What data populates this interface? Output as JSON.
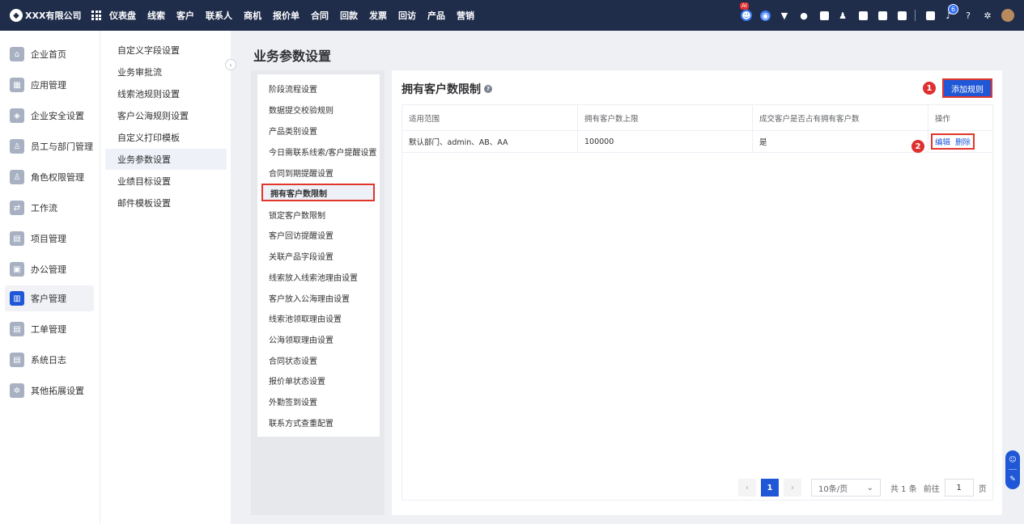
{
  "brand": {
    "name": "XXX有限公司"
  },
  "topnav": [
    "仪表盘",
    "线索",
    "客户",
    "联系人",
    "商机",
    "报价单",
    "合同",
    "回款",
    "发票",
    "回访",
    "产品",
    "营销"
  ],
  "topbar": {
    "ai_badge": "AI",
    "notice_count": "6"
  },
  "sidebar": [
    {
      "label": "企业首页",
      "icon": "home-icon"
    },
    {
      "label": "应用管理",
      "icon": "apps-icon"
    },
    {
      "label": "企业安全设置",
      "icon": "shield-icon"
    },
    {
      "label": "员工与部门管理",
      "icon": "users-icon"
    },
    {
      "label": "角色权限管理",
      "icon": "user-role-icon"
    },
    {
      "label": "工作流",
      "icon": "workflow-icon"
    },
    {
      "label": "项目管理",
      "icon": "project-icon"
    },
    {
      "label": "办公管理",
      "icon": "briefcase-icon"
    },
    {
      "label": "客户管理",
      "icon": "customer-icon",
      "active": true
    },
    {
      "label": "工单管理",
      "icon": "ticket-icon"
    },
    {
      "label": "系统日志",
      "icon": "log-icon"
    },
    {
      "label": "其他拓展设置",
      "icon": "extension-icon"
    }
  ],
  "submenu": [
    "自定义字段设置",
    "业务审批流",
    "线索池规则设置",
    "客户公海规则设置",
    "自定义打印模板",
    "业务参数设置",
    "业绩目标设置",
    "邮件模板设置"
  ],
  "page_title": "业务参数设置",
  "categories": [
    "阶段流程设置",
    "数据提交校验规则",
    "产品类别设置",
    "今日需联系线索/客户提醒设置",
    "合同到期提醒设置",
    "拥有客户数限制",
    "锁定客户数限制",
    "客户回访提醒设置",
    "关联产品字段设置",
    "线索放入线索池理由设置",
    "客户放入公海理由设置",
    "线索池领取理由设置",
    "公海领取理由设置",
    "合同状态设置",
    "报价单状态设置",
    "外勤签到设置",
    "联系方式查重配置"
  ],
  "active_category": "拥有客户数限制",
  "content": {
    "title": "拥有客户数限制",
    "add_button": "添加规则",
    "marker1": "1",
    "marker2": "2",
    "table": {
      "headers": [
        "适用范围",
        "拥有客户数上限",
        "成交客户是否占有拥有客户数",
        "操作"
      ],
      "rows": [
        {
          "scope": "默认部门、admin、AB、AA",
          "limit": "100000",
          "deal_counted": "是",
          "edit": "编辑",
          "delete": "删除"
        }
      ]
    },
    "pagination": {
      "current": "1",
      "page_size": "10条/页",
      "total": "共 1 条",
      "goto_label": "前往",
      "goto_value": "1",
      "page_unit": "页"
    }
  },
  "colors": {
    "topbar": "#1f2d4b",
    "accent": "#1f57d6",
    "highlight": "#e0362b"
  }
}
